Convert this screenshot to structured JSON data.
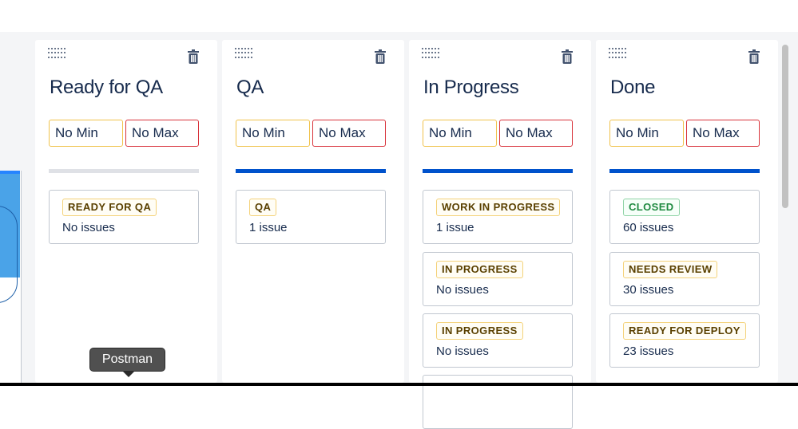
{
  "columns": [
    {
      "title": "Ready for QA",
      "min_label": "No Min",
      "max_label": "No Max",
      "progress_color": "#dfe1e6",
      "cards": [
        {
          "status": "READY FOR QA",
          "status_color": "yellow",
          "count": "No issues"
        }
      ]
    },
    {
      "title": "QA",
      "min_label": "No Min",
      "max_label": "No Max",
      "progress_color": "#0052cc",
      "cards": [
        {
          "status": "QA",
          "status_color": "yellow",
          "count": "1 issue"
        }
      ]
    },
    {
      "title": "In Progress",
      "min_label": "No Min",
      "max_label": "No Max",
      "progress_color": "#0052cc",
      "cards": [
        {
          "status": "WORK IN PROGRESS",
          "status_color": "yellow",
          "count": "1 issue"
        },
        {
          "status": "IN PROGRESS",
          "status_color": "yellow",
          "count": "No issues"
        },
        {
          "status": "IN PROGRESS",
          "status_color": "yellow",
          "count": "No issues"
        }
      ]
    },
    {
      "title": "Done",
      "min_label": "No Min",
      "max_label": "No Max",
      "progress_color": "#0052cc",
      "cards": [
        {
          "status": "CLOSED",
          "status_color": "green",
          "count": "60 issues"
        },
        {
          "status": "NEEDS REVIEW",
          "status_color": "yellow",
          "count": "30 issues"
        },
        {
          "status": "READY FOR DEPLOY",
          "status_color": "yellow",
          "count": "23 issues"
        }
      ]
    }
  ],
  "tooltip": {
    "text": "Postman"
  },
  "icons": {
    "drag": "drag-handle-icon",
    "delete": "trash-icon"
  },
  "colors": {
    "accent_blue": "#0052cc",
    "min_border": "#f0c24b",
    "max_border": "#d8333b"
  }
}
